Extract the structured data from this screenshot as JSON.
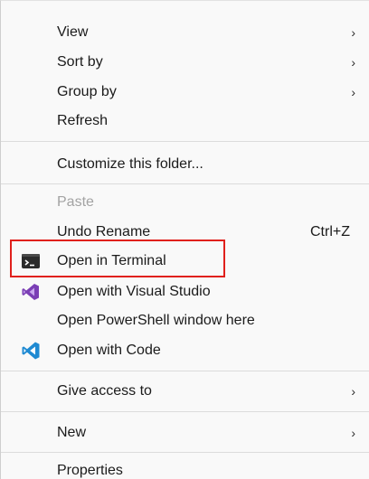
{
  "menu": {
    "view": "View",
    "sort_by": "Sort by",
    "group_by": "Group by",
    "refresh": "Refresh",
    "customize": "Customize this folder...",
    "paste": "Paste",
    "undo_rename": "Undo Rename",
    "undo_shortcut": "Ctrl+Z",
    "open_terminal": "Open in Terminal",
    "open_vs": "Open with Visual Studio",
    "open_powershell": "Open PowerShell window here",
    "open_code": "Open with Code",
    "give_access": "Give access to",
    "new": "New",
    "properties": "Properties",
    "chevron": "›"
  },
  "icons": {
    "terminal": "terminal-icon",
    "visual_studio": "visual-studio-icon",
    "vscode": "vscode-icon"
  },
  "colors": {
    "highlight_border": "#e0201c",
    "vs_purple": "#7b3fb5",
    "vscode_blue": "#1f8ad2"
  }
}
